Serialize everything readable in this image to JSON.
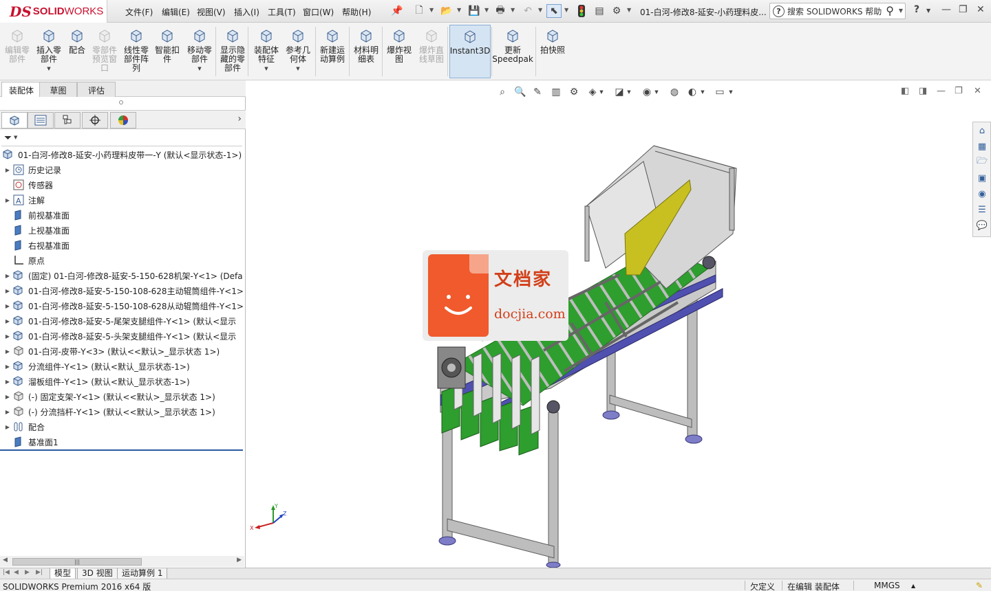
{
  "app": {
    "logo_ds": "DS",
    "logo_solid": "SOLID",
    "logo_works": "WORKS",
    "document_title": "01-白河-修改8-延安-小药理料皮...",
    "help_search_placeholder": "搜索 SOLIDWORKS 帮助",
    "help_label": "?"
  },
  "menu": [
    "文件(F)",
    "编辑(E)",
    "视图(V)",
    "插入(I)",
    "工具(T)",
    "窗口(W)",
    "帮助(H)"
  ],
  "ribbon": [
    {
      "label": "编辑零\n部件",
      "icon": "edit-component-icon",
      "disabled": true
    },
    {
      "label": "插入零\n部件",
      "icon": "insert-component-icon",
      "disabled": false
    },
    {
      "label": "配合",
      "icon": "mate-icon",
      "disabled": false
    },
    {
      "label": "零部件\n预览窗\n口",
      "icon": "component-preview-icon",
      "disabled": true
    },
    {
      "label": "线性零\n部件阵\n列",
      "icon": "linear-pattern-icon",
      "disabled": false
    },
    {
      "label": "智能扣\n件",
      "icon": "smart-fastener-icon",
      "disabled": false
    },
    {
      "label": "移动零\n部件",
      "icon": "move-component-icon",
      "disabled": false
    },
    {
      "label": "显示隐\n藏的零\n部件",
      "icon": "show-hidden-icon",
      "disabled": false
    },
    {
      "label": "装配体\n特征",
      "icon": "assembly-feature-icon",
      "disabled": false
    },
    {
      "label": "参考几\n何体",
      "icon": "reference-geometry-icon",
      "disabled": false
    },
    {
      "label": "新建运\n动算例",
      "icon": "motion-study-icon",
      "disabled": false
    },
    {
      "label": "材料明\n细表",
      "icon": "bom-icon",
      "disabled": false
    },
    {
      "label": "爆炸视\n图",
      "icon": "exploded-view-icon",
      "disabled": false
    },
    {
      "label": "爆炸直\n线草图",
      "icon": "explode-line-icon",
      "disabled": true
    },
    {
      "label": "Instant3D",
      "icon": "instant3d-icon",
      "disabled": false
    },
    {
      "label": "更新\nSpeedpak",
      "icon": "speedpak-icon",
      "disabled": false
    },
    {
      "label": "拍快照",
      "icon": "snapshot-icon",
      "disabled": false
    }
  ],
  "command_tabs": [
    "装配体",
    "草图",
    "评估"
  ],
  "tree": {
    "root": "01-白河-修改8-延安-小药理料皮带一-Y  (默认<显示状态-1>)",
    "items": [
      {
        "label": "历史记录",
        "icon": "history-icon",
        "expand": true
      },
      {
        "label": "传感器",
        "icon": "sensor-icon",
        "expand": false
      },
      {
        "label": "注解",
        "icon": "annotation-icon",
        "expand": true
      },
      {
        "label": "前视基准面",
        "icon": "plane-icon",
        "expand": false
      },
      {
        "label": "上视基准面",
        "icon": "plane-icon",
        "expand": false
      },
      {
        "label": "右视基准面",
        "icon": "plane-icon",
        "expand": false
      },
      {
        "label": "原点",
        "icon": "origin-icon",
        "expand": false
      },
      {
        "label": "(固定) 01-白河-修改8-延安-5-150-628机架-Y<1> (Defa",
        "icon": "subassembly-icon",
        "expand": true
      },
      {
        "label": "01-白河-修改8-延安-5-150-108-628主动辊筒组件-Y<1>",
        "icon": "subassembly-icon",
        "expand": true
      },
      {
        "label": "01-白河-修改8-延安-5-150-108-628从动辊筒组件-Y<1>",
        "icon": "subassembly-icon",
        "expand": true
      },
      {
        "label": "01-白河-修改8-延安-5-尾架支腿组件-Y<1> (默认<显示",
        "icon": "subassembly-icon",
        "expand": true
      },
      {
        "label": "01-白河-修改8-延安-5-头架支腿组件-Y<1> (默认<显示",
        "icon": "subassembly-icon",
        "expand": true
      },
      {
        "label": "01-白河-皮带-Y<3> (默认<<默认>_显示状态 1>)",
        "icon": "part-icon",
        "expand": true
      },
      {
        "label": "分流组件-Y<1> (默认<默认_显示状态-1>)",
        "icon": "subassembly-icon",
        "expand": true
      },
      {
        "label": "溜板组件-Y<1> (默认<默认_显示状态-1>)",
        "icon": "subassembly-icon",
        "expand": true
      },
      {
        "label": "(-) 固定支架-Y<1> (默认<<默认>_显示状态 1>)",
        "icon": "part-icon",
        "expand": true
      },
      {
        "label": "(-) 分流挡杆-Y<1> (默认<<默认>_显示状态 1>)",
        "icon": "part-icon",
        "expand": true
      },
      {
        "label": "配合",
        "icon": "mates-folder-icon",
        "expand": true
      },
      {
        "label": "基准面1",
        "icon": "plane-icon",
        "expand": false
      }
    ]
  },
  "bottom_tabs": [
    "模型",
    "3D 视图",
    "运动算例 1"
  ],
  "status": {
    "product": "SOLIDWORKS Premium 2016 x64 版",
    "state": "欠定义",
    "mode": "在编辑 装配体",
    "units": "MMGS"
  },
  "watermark": {
    "cn": "文档家",
    "en": "docjia.com"
  },
  "triad": {
    "x": "X",
    "y": "Y",
    "z": "Z"
  },
  "colors": {
    "brand_red": "#c8102e",
    "accent_blue": "#34609a",
    "conveyor_green": "#2e9e2e",
    "guide_purple": "#5050b0",
    "panel_yellow": "#c8c020"
  }
}
